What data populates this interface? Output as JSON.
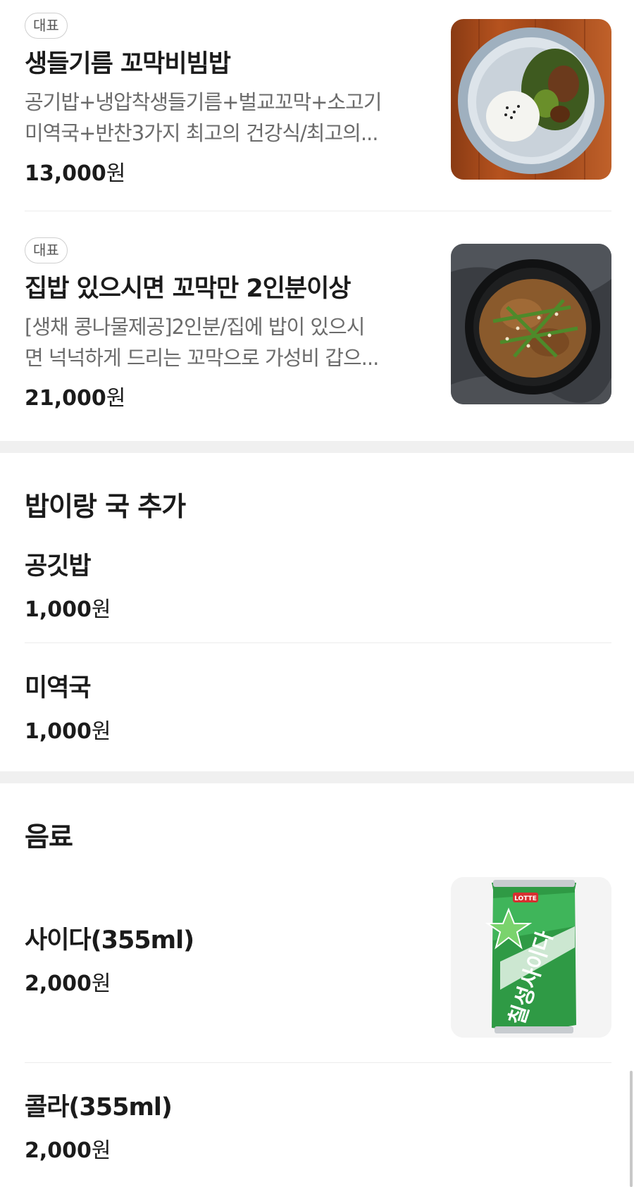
{
  "featured": [
    {
      "badge": "대표",
      "name": "생들기름 꼬막비빔밥",
      "desc_line1": "공기밥+냉압착생들기름+벌교꼬막+소고기",
      "desc_line2": "미역국+반찬3가지 최고의 건강식/최고의...",
      "price_amount": "13,000",
      "price_unit": "원"
    },
    {
      "badge": "대표",
      "name": "집밥 있으시면 꼬막만 2인분이상",
      "desc_line1": "[생채 콩나물제공]2인분/집에 밥이 있으시",
      "desc_line2": "면 넉넉하게 드리는 꼬막으로 가성비 갑으...",
      "price_amount": "21,000",
      "price_unit": "원"
    }
  ],
  "sections": [
    {
      "title": "밥이랑 국 추가",
      "items": [
        {
          "name": "공깃밥",
          "price_amount": "1,000",
          "price_unit": "원"
        },
        {
          "name": "미역국",
          "price_amount": "1,000",
          "price_unit": "원"
        }
      ]
    },
    {
      "title": "음료",
      "items": [
        {
          "name": "사이다(355ml)",
          "price_amount": "2,000",
          "price_unit": "원",
          "can_brand": "LOTTE",
          "can_label": "칠성사이다"
        },
        {
          "name": "콜라(355ml)",
          "price_amount": "2,000",
          "price_unit": "원"
        }
      ]
    }
  ]
}
